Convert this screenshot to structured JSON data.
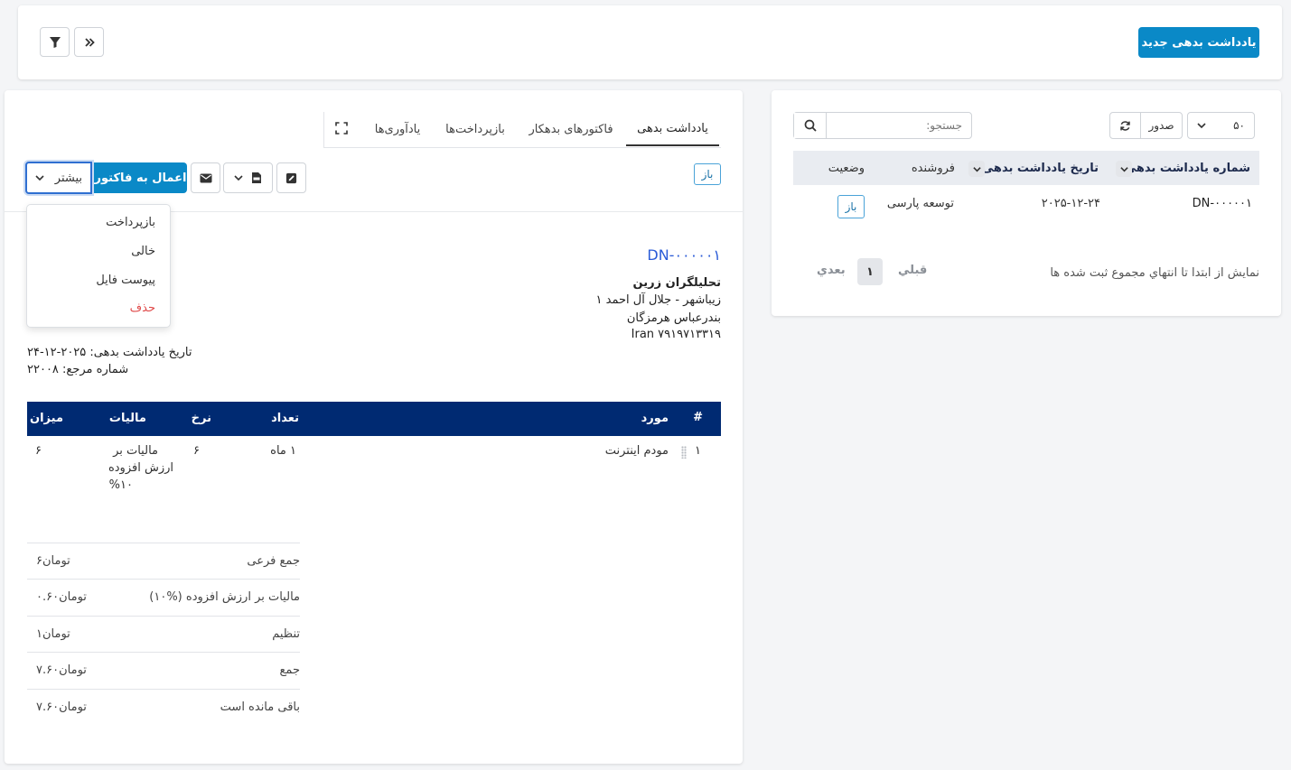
{
  "header": {
    "new_button": "یادداشت بدهی جدید"
  },
  "list": {
    "page_size": "۵۰",
    "export_label": "صدور",
    "search_placeholder": "جستجو:",
    "columns": {
      "number": "شماره یادداشت بدهی",
      "date": "تاریخ یادداشت بدهی",
      "vendor": "فروشنده",
      "status": "وضعیت"
    },
    "rows": [
      {
        "number": "DN-۰۰۰۰۰۱",
        "date": "۲۰۲۵-۱۲-۲۴",
        "vendor": "توسعه پارسی",
        "status": "باز"
      }
    ],
    "info_text": "نمایش از ابتدا تا انتهاي مجموع ثبت شده ها",
    "pagination": {
      "prev": "قبلي",
      "page": "۱",
      "next": "بعدي"
    }
  },
  "detail": {
    "tabs": [
      "یادداشت بدهی",
      "فاکتورهای بدهکار",
      "بازپرداخت‌ها",
      "یادآوری‌ها"
    ],
    "status_badge": "باز",
    "apply_button": "اعمال به فاکتور",
    "more_button": "بیشتر",
    "more_menu": {
      "refund": "بازپرداخت",
      "void": "خالی",
      "attach": "پیوست فایل",
      "delete": "حذف"
    },
    "note_number": "DN-۰۰۰۰۰۱",
    "vendor_name": "تحلیلگران زرین",
    "address_line1": "زیباشهر - جلال آل احمد ۱",
    "address_line2": "بندرعباس هرمزگان",
    "address_line3": "Iran ۷۹۱۹۷۱۳۳۱۹",
    "date_line": "تاریخ یادداشت بدهی: ۲۰۲۵-۱۲-۲۴",
    "ref_line": "شماره مرجع: ۲۲۰۰۸",
    "items_table": {
      "headers": {
        "num": "#",
        "item": "مورد",
        "qty": "تعداد",
        "rate": "نرخ",
        "tax": "مالیات",
        "amount": "میزان"
      },
      "rows": [
        {
          "num": "۱",
          "item": "مودم اینترنت",
          "qty": "۱ ماه",
          "rate": "۶",
          "tax_line1": "مالیات بر",
          "tax_line2": "ارزش افزوده",
          "tax_line3": "%۱۰",
          "amount": "۶"
        }
      ]
    },
    "summary": [
      {
        "label": "جمع فرعی",
        "value": "۶تومان"
      },
      {
        "label": "مالیات بر ارزش افزوده (%۱۰)",
        "value": "۰.۶۰تومان"
      },
      {
        "label": "تنظیم",
        "value": "۱تومان"
      },
      {
        "label": "جمع",
        "value": "۷.۶۰تومان"
      },
      {
        "label": "باقی مانده است",
        "value": "۷.۶۰تومان"
      }
    ]
  },
  "colors": {
    "primary": "#0a89c7",
    "table_header": "#002a72",
    "danger": "#e04b4b",
    "link": "#2a5bd7"
  }
}
